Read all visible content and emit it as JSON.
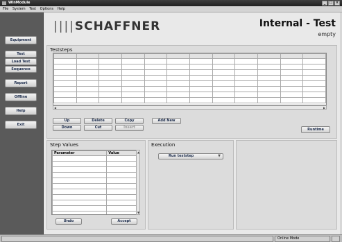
{
  "window": {
    "title": "WinModule"
  },
  "menu": [
    "File",
    "System",
    "Test",
    "Options",
    "Help"
  ],
  "sidebar": {
    "items": [
      "Equipment",
      "Test",
      "Load Test",
      "Sequence",
      "Report",
      "Offline",
      "Help",
      "Exit"
    ]
  },
  "header": {
    "logo": "SCHAFFNER",
    "logo_bars": "||||",
    "title": "Internal - Test",
    "subtitle": "empty"
  },
  "teststeps": {
    "title": "Teststeps",
    "column_count": 12,
    "row_count": 8,
    "buttons": {
      "up": "Up",
      "delete": "Delete",
      "copy": "Copy",
      "down": "Down",
      "cut": "Cut",
      "insert": "Insert",
      "add_new": "Add New",
      "runtime": "Runtime"
    }
  },
  "step_values": {
    "title": "Step Values",
    "columns": [
      "Parameter",
      "Value"
    ],
    "row_count": 11,
    "buttons": {
      "undo": "Undo",
      "accept": "Accept"
    }
  },
  "execution": {
    "title": "Execution",
    "dropdown": "Run teststep"
  },
  "status": {
    "mode": "Online Mode"
  }
}
